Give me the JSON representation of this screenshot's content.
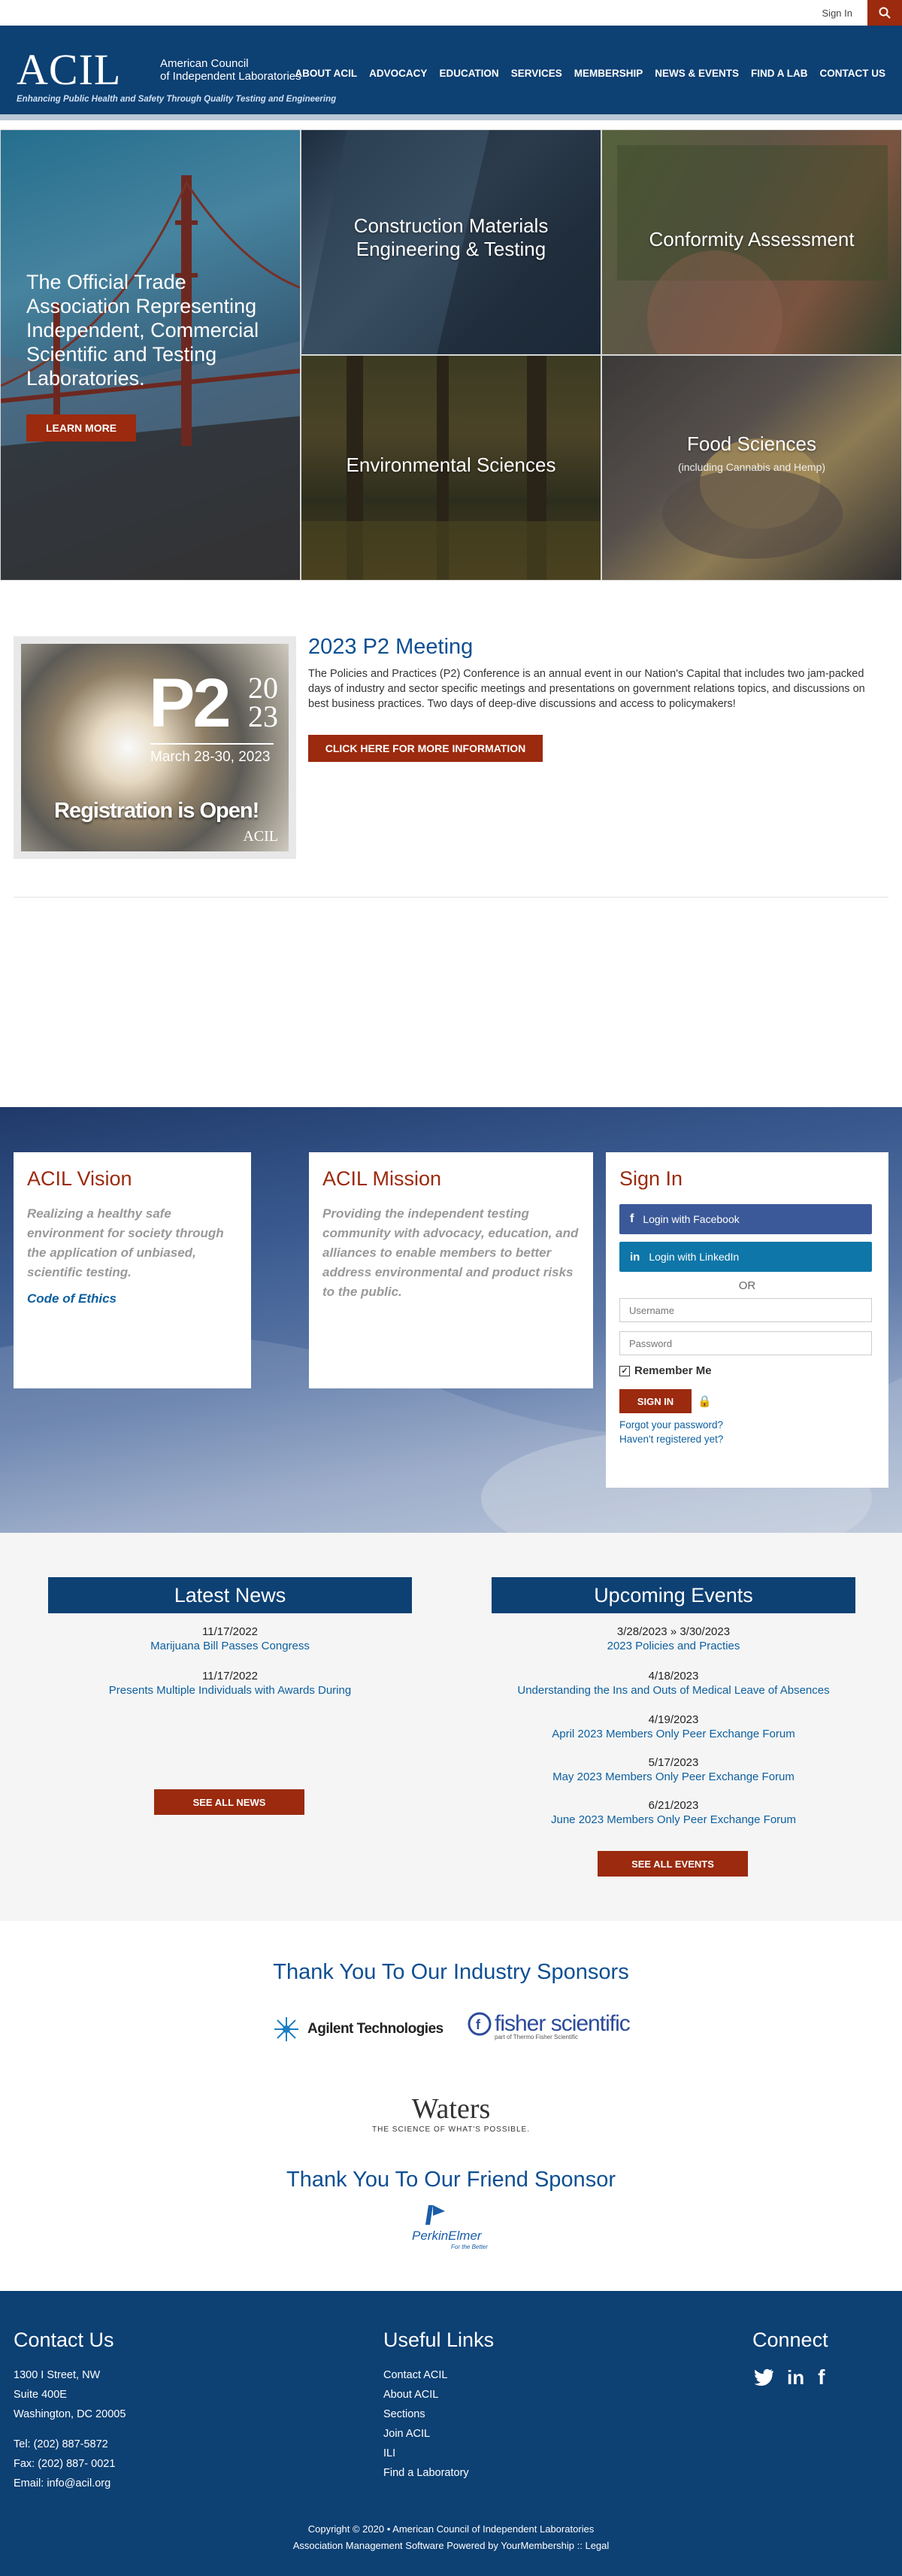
{
  "topbar": {
    "signin": "Sign In",
    "search_icon": "search-icon"
  },
  "header": {
    "logo_main": "ACIL",
    "logo_org_line1": "American Council",
    "logo_org_line2": "of Independent Laboratories",
    "tagline": "Enhancing Public Health and Safety Through Quality Testing and Engineering",
    "nav": [
      "ABOUT ACIL",
      "ADVOCACY",
      "EDUCATION",
      "SERVICES",
      "MEMBERSHIP",
      "NEWS & EVENTS",
      "FIND A LAB",
      "CONTACT US"
    ]
  },
  "hero": {
    "headline": "The Official Trade Association Representing Independent, Commercial Scientific and Testing Laboratories.",
    "learn_more": "LEARN MORE",
    "tiles": {
      "construction": "Construction Materials Engineering & Testing",
      "conformity": "Conformity Assessment",
      "environmental": "Environmental Sciences",
      "food": "Food Sciences",
      "food_sub": "(including Cannabis and Hemp)"
    }
  },
  "p2": {
    "image": {
      "big": "P2",
      "year_top": "20",
      "year_bottom": "23",
      "dates": "March 28-30, 2023",
      "registration": "Registration is Open!",
      "mark": "ACIL"
    },
    "title": "2023 P2 Meeting",
    "text": "The Policies and Practices (P2) Conference is an annual event in our Nation's Capital that includes two jam-packed days of industry and sector specific meetings and presentations on government relations topics, and discussions on best business practices. Two days of deep-dive discussions and access to policymakers!",
    "button": "CLICK HERE FOR MORE INFORMATION"
  },
  "vision": {
    "title": "ACIL Vision",
    "text": "Realizing a healthy safe environment for society through the application of unbiased, scientific testing.",
    "link": "Code of Ethics"
  },
  "mission": {
    "title": "ACIL Mission",
    "text": "Providing the independent testing community with advocacy, education, and alliances to enable members to better address environmental and product risks to the public."
  },
  "signin": {
    "title": "Sign In",
    "facebook": "Login with Facebook",
    "linkedin": "Login with LinkedIn",
    "or": "OR",
    "username_placeholder": "Username",
    "password_placeholder": "Password",
    "remember": "Remember Me",
    "button": "SIGN IN",
    "forgot": "Forgot your password?",
    "register": "Haven't registered yet?"
  },
  "news": {
    "title": "Latest News",
    "items": [
      {
        "date": "11/17/2022",
        "title": "Marijuana Bill Passes Congress"
      },
      {
        "date": "11/17/2022",
        "title": "Presents Multiple Individuals with Awards During"
      }
    ],
    "button": "SEE ALL NEWS"
  },
  "events": {
    "title": "Upcoming Events",
    "items": [
      {
        "date": "3/28/2023 » 3/30/2023",
        "title": "2023 Policies and Practies"
      },
      {
        "date": "4/18/2023",
        "title": "Understanding the Ins and Outs of Medical Leave of Absences"
      },
      {
        "date": "4/19/2023",
        "title": "April 2023 Members Only Peer Exchange Forum"
      },
      {
        "date": "5/17/2023",
        "title": "May 2023 Members Only Peer Exchange Forum"
      },
      {
        "date": "6/21/2023",
        "title": "June 2023 Members Only Peer Exchange Forum"
      }
    ],
    "button": "SEE ALL EVENTS"
  },
  "sponsors": {
    "industry_title": "Thank You To Our Industry Sponsors",
    "agilent": "Agilent Technologies",
    "fisher": "fisher scientific",
    "fisher_sub": "part of Thermo Fisher Scientific",
    "waters": "Waters",
    "waters_sub": "THE SCIENCE OF WHAT'S POSSIBLE.",
    "friend_title": "Thank You To Our Friend Sponsor",
    "perkin": "PerkinElmer",
    "perkin_sub": "For the Better"
  },
  "footer": {
    "contact_title": "Contact Us",
    "address": [
      "1300 I Street, NW",
      "Suite 400E",
      "Washington, DC 20005"
    ],
    "tel": "Tel: (202) 887-5872",
    "fax": "Fax: (202) 887- 0021",
    "email": "Email: info@acil.org",
    "links_title": "Useful Links",
    "links": [
      "Contact ACIL",
      "About ACIL",
      "Sections",
      "Join ACIL",
      "ILI",
      "Find a Laboratory"
    ],
    "connect_title": "Connect",
    "copyright": "Copyright © 2020 • American Council of Independent Laboratories",
    "powered": "Association Management Software Powered by YourMembership  ::  Legal"
  },
  "colors": {
    "navy": "#0d4073",
    "accent": "#9b2a0e",
    "link": "#0d5f9e",
    "facebook": "#3b5998",
    "linkedin": "#0e76a8"
  }
}
